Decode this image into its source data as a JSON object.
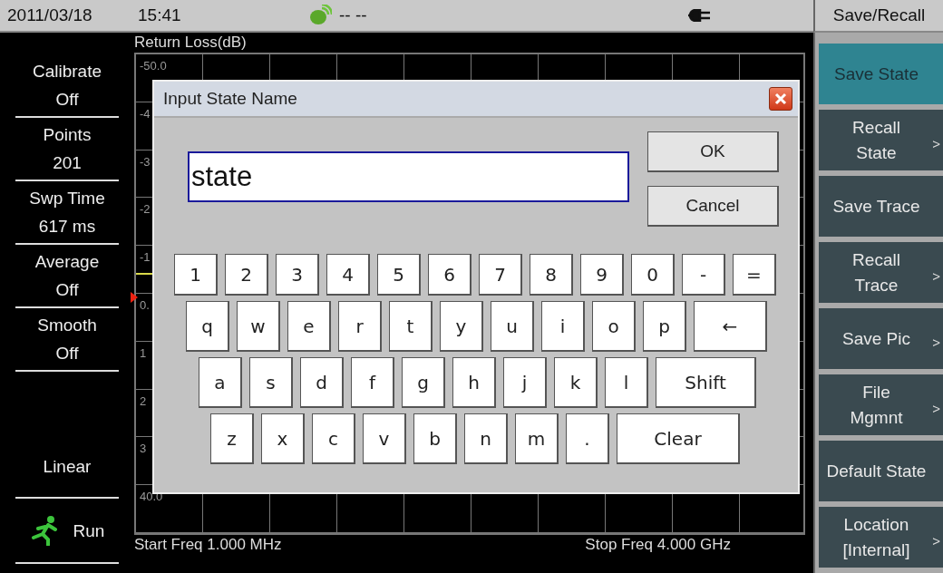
{
  "status_bar": {
    "date": "2011/03/18",
    "time": "15:41",
    "gps": "-- --"
  },
  "sidebar": {
    "items": [
      {
        "label": "Calibrate",
        "value": "Off"
      },
      {
        "label": "Points",
        "value": "201"
      },
      {
        "label": "Swp Time",
        "value": "617 ms"
      },
      {
        "label": "Average",
        "value": "Off"
      },
      {
        "label": "Smooth",
        "value": "Off"
      }
    ],
    "scale": "Linear",
    "run": "Run"
  },
  "chart": {
    "title": "Return Loss(dB)",
    "y_labels": [
      "-50.0",
      "-4",
      "-3",
      "-2",
      "-1",
      "0.",
      "1",
      "2",
      "3",
      "40.0"
    ],
    "start": "Start Freq 1.000 MHz",
    "stop": "Stop Freq 4.000 GHz"
  },
  "menu": {
    "title": "Save/Recall",
    "items": [
      {
        "label": "Save State",
        "selected": true
      },
      {
        "label": "Recall\nState",
        "selected": false,
        "arrow": ">"
      },
      {
        "label": "Save Trace",
        "selected": false
      },
      {
        "label": "Recall\nTrace",
        "selected": false,
        "arrow": ">"
      },
      {
        "label": "Save Pic",
        "selected": false,
        "arrow": ">"
      },
      {
        "label": "File\nMgmnt",
        "selected": false,
        "arrow": ">"
      },
      {
        "label": "Default State",
        "selected": false
      },
      {
        "label": "Location\n[Internal]",
        "selected": false,
        "arrow": ">"
      }
    ]
  },
  "dialog": {
    "title": "Input State Name",
    "value": "state",
    "buttons": [
      "OK",
      "Cancel"
    ],
    "keys": [
      [
        {
          "label": "1",
          "kind": "char"
        },
        {
          "label": "2",
          "kind": "char"
        },
        {
          "label": "3",
          "kind": "char"
        },
        {
          "label": "4",
          "kind": "char"
        },
        {
          "label": "5",
          "kind": "char"
        },
        {
          "label": "6",
          "kind": "char"
        },
        {
          "label": "7",
          "kind": "char"
        },
        {
          "label": "8",
          "kind": "char"
        },
        {
          "label": "9",
          "kind": "char"
        },
        {
          "label": "0",
          "kind": "char"
        },
        {
          "label": "-",
          "kind": "char"
        },
        {
          "label": "=",
          "kind": "char"
        }
      ],
      [
        {
          "label": "q",
          "kind": "char"
        },
        {
          "label": "w",
          "kind": "char"
        },
        {
          "label": "e",
          "kind": "char"
        },
        {
          "label": "r",
          "kind": "char"
        },
        {
          "label": "t",
          "kind": "char"
        },
        {
          "label": "y",
          "kind": "char"
        },
        {
          "label": "u",
          "kind": "char"
        },
        {
          "label": "i",
          "kind": "char"
        },
        {
          "label": "o",
          "kind": "char"
        },
        {
          "label": "p",
          "kind": "char"
        },
        {
          "label": "←",
          "kind": "backspace"
        }
      ],
      [
        {
          "label": "a",
          "kind": "char"
        },
        {
          "label": "s",
          "kind": "char"
        },
        {
          "label": "d",
          "kind": "char"
        },
        {
          "label": "f",
          "kind": "char"
        },
        {
          "label": "g",
          "kind": "char"
        },
        {
          "label": "h",
          "kind": "char"
        },
        {
          "label": "j",
          "kind": "char"
        },
        {
          "label": "k",
          "kind": "char"
        },
        {
          "label": "l",
          "kind": "char"
        },
        {
          "label": "Shift",
          "kind": "shift"
        }
      ],
      [
        {
          "label": "z",
          "kind": "char"
        },
        {
          "label": "x",
          "kind": "char"
        },
        {
          "label": "c",
          "kind": "char"
        },
        {
          "label": "v",
          "kind": "char"
        },
        {
          "label": "b",
          "kind": "char"
        },
        {
          "label": "n",
          "kind": "char"
        },
        {
          "label": "m",
          "kind": "char"
        },
        {
          "label": ".",
          "kind": "char"
        },
        {
          "label": "Clear",
          "kind": "clear"
        }
      ]
    ]
  }
}
